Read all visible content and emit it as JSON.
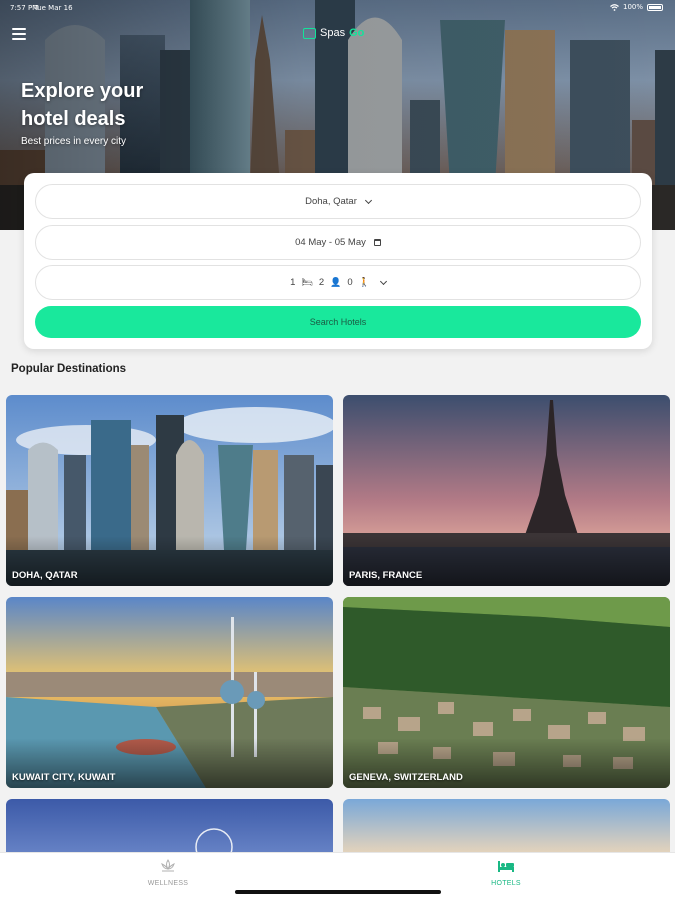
{
  "status_bar": {
    "time": "7:57 PM",
    "date": "Tue Mar 16",
    "battery": "100%",
    "icons": [
      "wifi-icon",
      "battery-icon"
    ]
  },
  "app": {
    "logo_main": "Spas",
    "logo_accent": "Go",
    "menu_icon": "hamburger-menu-icon"
  },
  "hero": {
    "title": "Explore your hotel deals",
    "subtitle": "Best prices in every city"
  },
  "search": {
    "destination": "Doha, Qatar",
    "dates": "04 May - 05 May",
    "rooms": "1",
    "adults": "2",
    "children": "0",
    "button_label": "Search Hotels"
  },
  "popular": {
    "title": "Popular Destinations",
    "destinations": [
      {
        "label": "DOHA, QATAR"
      },
      {
        "label": "PARIS, FRANCE"
      },
      {
        "label": "KUWAIT CITY, KUWAIT"
      },
      {
        "label": "GENEVA, SWITZERLAND"
      }
    ]
  },
  "tabs": {
    "wellness": "WELLNESS",
    "hotels": "HOTELS",
    "active": "HOTELS"
  },
  "colors": {
    "accent": "#19e89c",
    "active_tab": "#19b884",
    "background": "#f2f2f2"
  }
}
